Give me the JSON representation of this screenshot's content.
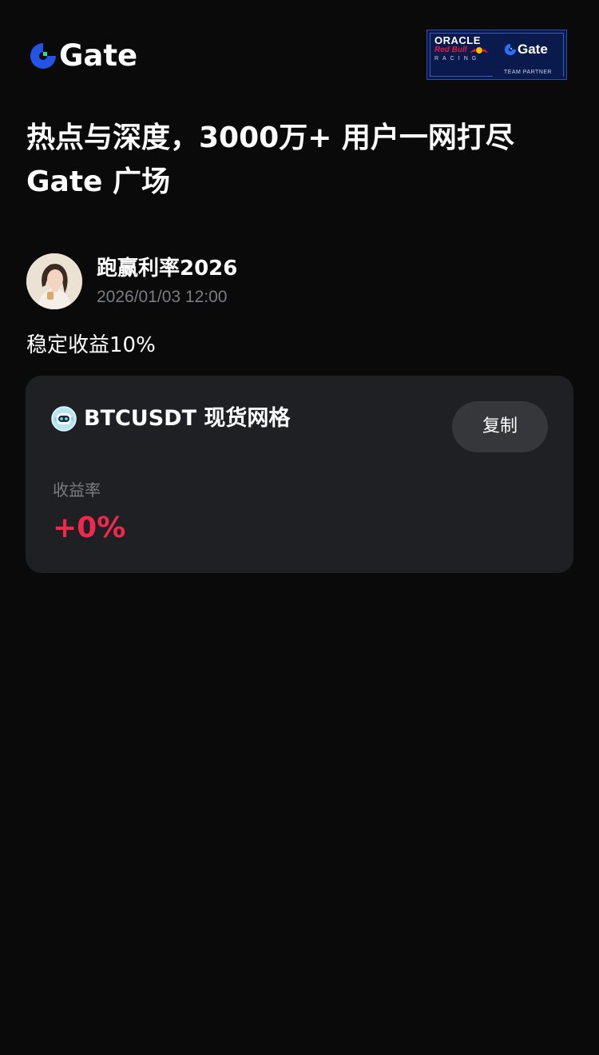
{
  "header": {
    "brand": "Gate",
    "partner_badge": {
      "line1": "ORACLE",
      "line2": "Red Bull",
      "line3": "RACING",
      "brand": "Gate",
      "footer": "TEAM PARTNER"
    }
  },
  "headline": {
    "line1": "热点与深度，3000万+ 用户一网打尽",
    "line2": "Gate 广场"
  },
  "post": {
    "author_name": "跑赢利率2026",
    "timestamp": "2026/01/03 12:00",
    "body": "稳定收益10%"
  },
  "strategy_card": {
    "title": "BTCUSDT 现货网格",
    "copy_label": "复制",
    "yield_label": "收益率",
    "yield_value": "+0%"
  },
  "colors": {
    "background": "#0a0a0b",
    "card": "#1f2023",
    "accent_negative": "#f0284e",
    "brand_blue": "#2354e6",
    "brand_green": "#17e6a1"
  },
  "icons": {
    "logo": "gate-logo-icon",
    "bot": "trading-bot-icon"
  }
}
